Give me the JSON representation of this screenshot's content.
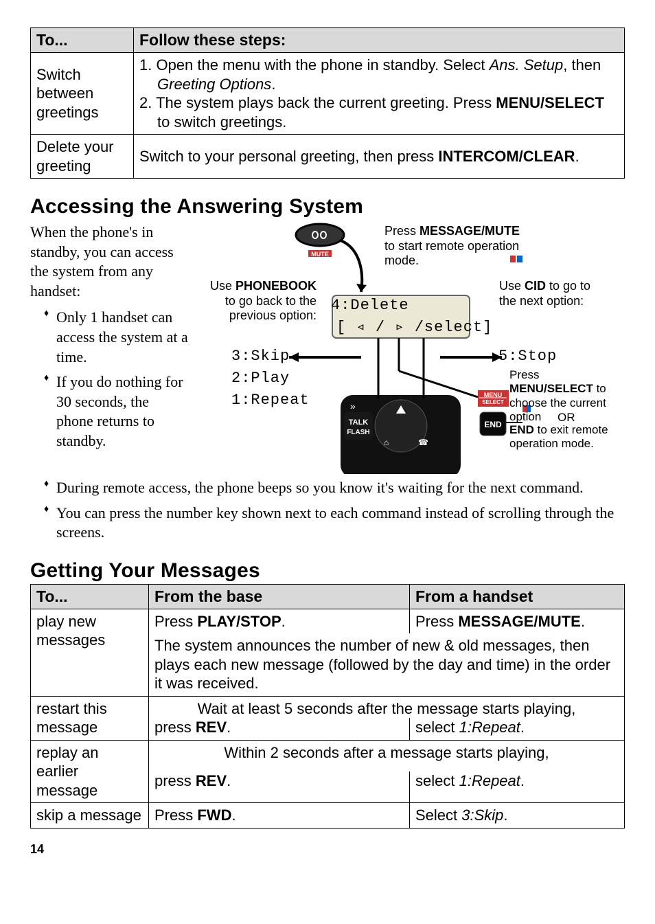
{
  "table1": {
    "headers": [
      "To...",
      "Follow these steps:"
    ],
    "rows": [
      {
        "c1": "Switch between greetings",
        "c2_pre1": "1. Open the menu with the phone in standby. Select ",
        "c2_i1": "Ans. Setup",
        "c2_mid1": ", then ",
        "c2_i2": "Greeting Options",
        "c2_post1": ".",
        "c2_pre2": "2. The system plays back the current greeting. Press ",
        "c2_b1": "MENU/SELECT",
        "c2_post2": " to switch greetings."
      },
      {
        "c1": "Delete your greeting",
        "c2_pre": "Switch to your personal greeting, then press ",
        "c2_b": "INTERCOM/CLEAR",
        "c2_post": "."
      }
    ]
  },
  "h2a": "Accessing the Answering System",
  "intro": "When the phone's in standby, you can access the system from any handset:",
  "bullets1": [
    "Only 1 handset can access the system at a time.",
    "If you do nothing for 30 seconds, the phone returns to standby."
  ],
  "bullets2": [
    "During remote access, the phone beeps so you know it's waiting for the next command.",
    "You can press the number key shown next to each command instead of scrolling through the screens."
  ],
  "figure": {
    "top_pre": "Press ",
    "top_b": "MESSAGE/MUTE",
    "top_post": " to start remote operation mode.",
    "left_pre": "Use ",
    "left_b": "PHONEBOOK",
    "left_post": " to go back to the previous option:",
    "right_pre": "Use ",
    "right_b": "CID",
    "right_post": " to go to the next option:",
    "menu_pre": "Press ",
    "menu_b": "MENU/SELECT",
    "menu_post": " to choose the current option",
    "or": "OR",
    "end_b": "END",
    "end_post": " to exit remote operation mode.",
    "lcd_line1": "4:Delete",
    "lcd_line2": "[ ◃ / ▹ /select]",
    "opt_skip": "3:Skip",
    "opt_play": "2:Play",
    "opt_repeat": "1:Repeat",
    "opt_stop": "5:Stop",
    "btn_mute": "MUTE",
    "btn_talk1": "TALK",
    "btn_talk2": "FLASH",
    "btn_menu1": "MENU",
    "btn_menu2": "SELECT",
    "btn_end": "END"
  },
  "h2b": "Getting Your Messages",
  "table2": {
    "headers": [
      "To...",
      "From the base",
      "From a handset"
    ],
    "row1": {
      "c1": "play new messages",
      "base_pre": "Press ",
      "base_b": "PLAY/STOP",
      "base_post": ".",
      "hand_pre": "Press ",
      "hand_b": "MESSAGE/MUTE",
      "hand_post": ".",
      "merged": "The system announces the number of new & old messages, then plays each new message (followed by the day and time) in the order it was received."
    },
    "row2": {
      "c1": "restart this message",
      "span_text": "Wait at least 5 seconds after the message starts playing,",
      "base_pre": "press ",
      "base_b": "REV",
      "base_post": ".",
      "hand_pre": "select ",
      "hand_i": "1:Repeat",
      "hand_post": "."
    },
    "row3": {
      "c1": "replay an earlier message",
      "span_text": "Within 2 seconds after a message starts playing,",
      "base_pre": "press ",
      "base_b": "REV",
      "base_post": ".",
      "hand_pre": "select ",
      "hand_i": "1:Repeat",
      "hand_post": "."
    },
    "row4": {
      "c1": "skip a message",
      "base_pre": "Press ",
      "base_b": "FWD",
      "base_post": ".",
      "hand_pre": "Select ",
      "hand_i": "3:Skip",
      "hand_post": "."
    }
  },
  "pageNum": "14"
}
